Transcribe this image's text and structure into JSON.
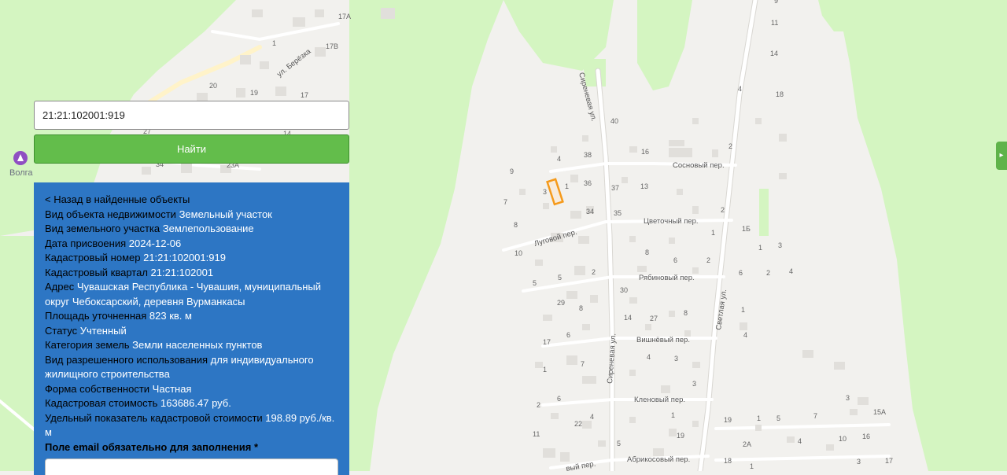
{
  "search": {
    "value": "21:21:102001:919",
    "button_label": "Найти"
  },
  "info": {
    "back_label": "< Назад в найденные объекты",
    "rows": [
      {
        "key": "Вид объекта недвижимости",
        "value": "Земельный участок"
      },
      {
        "key": "Вид земельного участка",
        "value": "Землепользование"
      },
      {
        "key": "Дата присвоения",
        "value": "2024-12-06"
      },
      {
        "key": "Кадастровый номер",
        "value": "21:21:102001:919"
      },
      {
        "key": "Кадастровый квартал",
        "value": "21:21:102001"
      },
      {
        "key": "Адрес",
        "value": "Чувашская Республика - Чувашия, муниципальный округ Чебоксарский, деревня Вурманкасы"
      },
      {
        "key": "Площадь уточненная",
        "value": "823 кв. м"
      },
      {
        "key": "Статус",
        "value": "Учтенный"
      },
      {
        "key": "Категория земель",
        "value": "Земли населенных пунктов"
      },
      {
        "key": "Вид разрешенного использования",
        "value": "для индивидуального жилищного строительства"
      },
      {
        "key": "Форма собственности",
        "value": "Частная"
      },
      {
        "key": "Кадастровая стоимость",
        "value": "163686.47 руб."
      },
      {
        "key": "Удельный показатель кадастровой стоимости",
        "value": "198.89 руб./кв. м"
      }
    ],
    "email_label": "Поле email обязательно для заполнения *"
  },
  "map": {
    "colors": {
      "background": "#f2f1ee",
      "forest": "#d4f5c1",
      "road": "#ffffff",
      "road_casing": "#d9d7d2",
      "building": "#e1dfdb",
      "parcel": "#f59a1b"
    },
    "poi": {
      "label": "Волга",
      "icon": "park-icon"
    },
    "streets": [
      "ул. Берёзка",
      "Сиреневая ул.",
      "Сосновый пер.",
      "Цветочный пер.",
      "Луговой пер.",
      "Рябиновый пер.",
      "Светлая ул.",
      "Вишнёвый пер.",
      "Сиреневая ул.",
      "Кленовый пер.",
      "Абрикосовый пер.",
      "вый пер."
    ],
    "house_numbers": [
      "17А",
      "1",
      "17В",
      "20",
      "19",
      "17",
      "14",
      "27",
      "34",
      "23А",
      "9",
      "11",
      "14",
      "4",
      "18",
      "40",
      "16",
      "38",
      "4",
      "2",
      "9",
      "1",
      "36",
      "37",
      "13",
      "3",
      "7",
      "34",
      "35",
      "2",
      "8",
      "1Б",
      "1",
      "10",
      "3",
      "5",
      "1",
      "8",
      "6",
      "2",
      "2",
      "4",
      "6",
      "5",
      "2",
      "30",
      "29",
      "8",
      "1",
      "14",
      "27",
      "8",
      "4",
      "17",
      "6",
      "4",
      "3",
      "1",
      "7",
      "3",
      "2",
      "6",
      "4",
      "22",
      "1",
      "3",
      "15А",
      "19",
      "1",
      "5",
      "7",
      "11",
      "5",
      "19",
      "2А",
      "4",
      "10",
      "16",
      "18",
      "1",
      "3",
      "17",
      "22"
    ]
  }
}
